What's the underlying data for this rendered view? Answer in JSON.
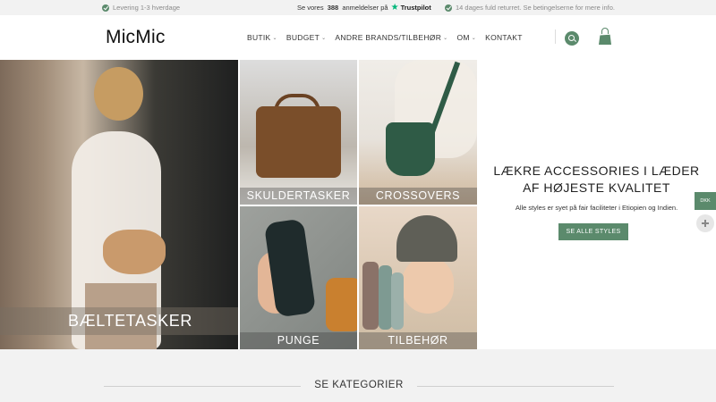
{
  "topbar": {
    "left": "Levering 1-3 hverdage",
    "mid_prefix": "Se vores",
    "mid_count": "388",
    "mid_suffix": "anmeldelser på",
    "trustpilot": "Trustpilot",
    "right": "14 dages fuld returret. Se betingelserne for mere info."
  },
  "header": {
    "logo": "MicMic",
    "nav": [
      {
        "label": "BUTIK",
        "dropdown": true
      },
      {
        "label": "BUDGET",
        "dropdown": true
      },
      {
        "label": "ANDRE BRANDS/TILBEHØR",
        "dropdown": true
      },
      {
        "label": "OM",
        "dropdown": true
      },
      {
        "label": "KONTAKT",
        "dropdown": false
      }
    ],
    "icons": [
      "search-icon",
      "shopping-bag-icon"
    ]
  },
  "tiles": {
    "beltetasker": "BÆLTETASKER",
    "skuldertasker": "SKULDERTASKER",
    "crossovers": "CROSSOVERS",
    "punge": "PUNGE",
    "tilbehor": "TILBEHØR"
  },
  "promo": {
    "title_line1": "LÆKRE ACCESSORIES I LÆDER",
    "title_line2": "AF HØJESTE KVALITET",
    "subtitle": "Alle styles er syet på fair faciliteter i Etiopien og Indien.",
    "cta": "SE ALLE STYLES"
  },
  "side": {
    "currency": "DKK"
  },
  "categories": {
    "title": "SE KATEGORIER"
  },
  "colors": {
    "accent": "#5b8a6c",
    "trustpilot": "#00b67a",
    "topbar_bg": "#f2f2f2"
  }
}
